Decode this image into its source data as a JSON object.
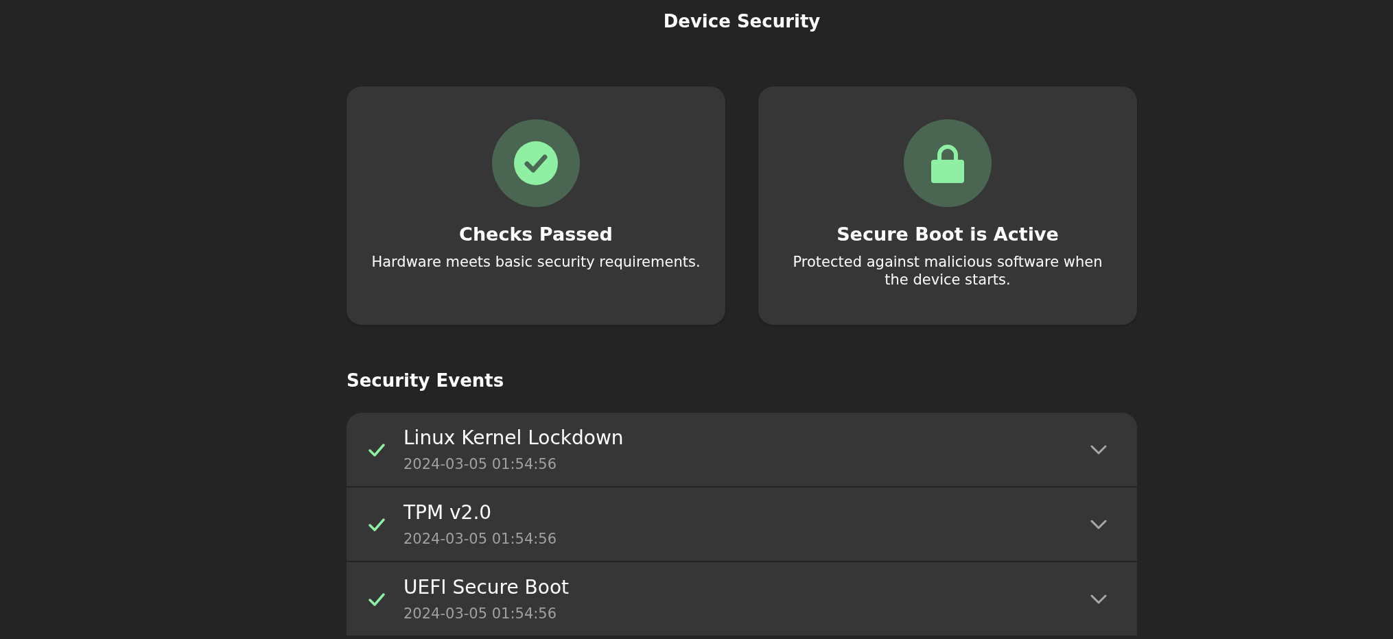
{
  "header": {
    "title": "Device Security"
  },
  "cards": [
    {
      "kind": "check",
      "title": "Checks Passed",
      "description": "Hardware meets basic security requirements."
    },
    {
      "kind": "lock",
      "title": "Secure Boot is Active",
      "description": "Protected against malicious software when the device starts."
    }
  ],
  "events_heading": "Security Events",
  "events": [
    {
      "kind": "passed",
      "name": "Linux Kernel Lockdown",
      "time": "2024-03-05 01:54:56",
      "expanded": false
    },
    {
      "kind": "passed",
      "name": "TPM v2.0",
      "time": "2024-03-05 01:54:56",
      "expanded": false
    },
    {
      "kind": "passed",
      "name": "UEFI Secure Boot",
      "time": "2024-03-05 01:54:56",
      "expanded": false
    }
  ]
}
